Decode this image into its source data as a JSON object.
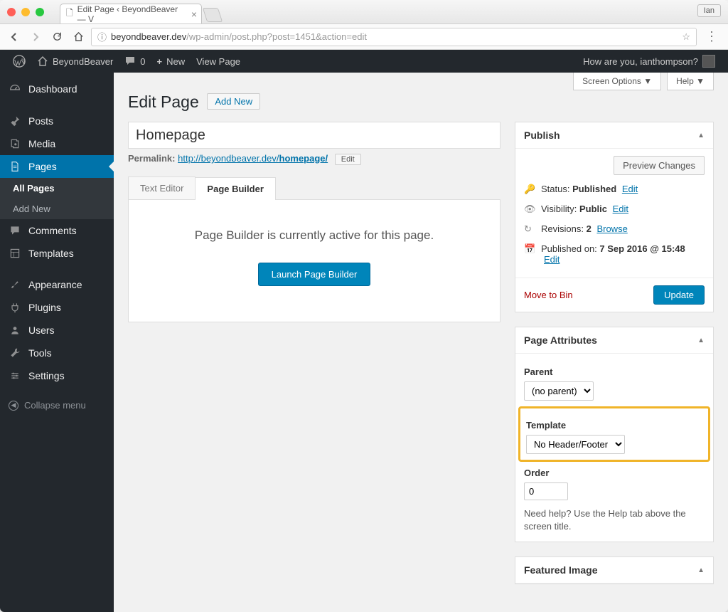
{
  "browser": {
    "tab_title": "Edit Page ‹ BeyondBeaver — V",
    "user_pill": "Ian",
    "url_dark": "beyondbeaver.dev",
    "url_grey": "/wp-admin/post.php?post=1451&action=edit"
  },
  "adminbar": {
    "site": "BeyondBeaver",
    "comments": "0",
    "new": "New",
    "view": "View Page",
    "greeting": "How are you, ianthompson?"
  },
  "sidebar": {
    "dashboard": "Dashboard",
    "posts": "Posts",
    "media": "Media",
    "pages": "Pages",
    "all_pages": "All Pages",
    "add_new": "Add New",
    "comments": "Comments",
    "templates": "Templates",
    "appearance": "Appearance",
    "plugins": "Plugins",
    "users": "Users",
    "tools": "Tools",
    "settings": "Settings",
    "collapse": "Collapse menu"
  },
  "screen": {
    "options": "Screen Options",
    "help": "Help"
  },
  "page": {
    "heading": "Edit Page",
    "add_new": "Add New",
    "title_value": "Homepage",
    "permalink_label": "Permalink:",
    "permalink_base": "http://beyondbeaver.dev/",
    "permalink_slug": "homepage/",
    "permalink_edit": "Edit"
  },
  "editor": {
    "tab_text": "Text Editor",
    "tab_builder": "Page Builder",
    "message": "Page Builder is currently active for this page.",
    "launch": "Launch Page Builder"
  },
  "publish": {
    "box_title": "Publish",
    "preview": "Preview Changes",
    "status_label": "Status:",
    "status_value": "Published",
    "status_edit": "Edit",
    "visibility_label": "Visibility:",
    "visibility_value": "Public",
    "visibility_edit": "Edit",
    "revisions_label": "Revisions:",
    "revisions_value": "2",
    "revisions_browse": "Browse",
    "published_label": "Published on:",
    "published_value": "7 Sep 2016 @ 15:48",
    "published_edit": "Edit",
    "trash": "Move to Bin",
    "update": "Update"
  },
  "attributes": {
    "box_title": "Page Attributes",
    "parent_label": "Parent",
    "parent_value": "(no parent)",
    "template_label": "Template",
    "template_value": "No Header/Footer",
    "order_label": "Order",
    "order_value": "0",
    "help": "Need help? Use the Help tab above the screen title."
  },
  "featured": {
    "box_title": "Featured Image"
  }
}
